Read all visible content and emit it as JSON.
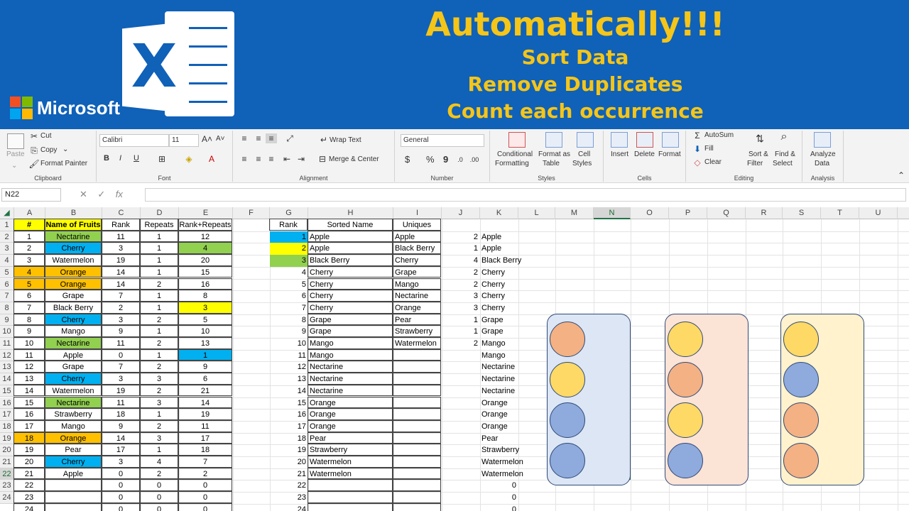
{
  "banner": {
    "title": "Automatically!!!",
    "line1": "Sort Data",
    "line2": "Remove Duplicates",
    "line3": "Count each occurrence",
    "brand": "Microsoft",
    "logo_letter": "X",
    "colors": {
      "bg": "#1061b8",
      "title": "#f5c518"
    }
  },
  "ribbon": {
    "clipboard": {
      "paste": "Paste",
      "cut": "Cut",
      "copy": "Copy",
      "format_painter": "Format Painter",
      "label": "Clipboard"
    },
    "font": {
      "name": "Calibri",
      "size": "11",
      "bold": "B",
      "italic": "I",
      "underline": "U",
      "label": "Font"
    },
    "alignment": {
      "wrap": "Wrap Text",
      "merge": "Merge & Center",
      "label": "Alignment"
    },
    "number": {
      "format": "General",
      "currency": "$",
      "percent": "%",
      "comma": "9",
      "label": "Number"
    },
    "styles": {
      "cond1": "Conditional",
      "cond2": "Formatting",
      "fmt1": "Format as",
      "fmt2": "Table",
      "cell1": "Cell",
      "cell2": "Styles",
      "label": "Styles"
    },
    "cells": {
      "insert": "Insert",
      "delete": "Delete",
      "format": "Format",
      "label": "Cells"
    },
    "editing": {
      "autosum": "AutoSum",
      "fill": "Fill",
      "clear": "Clear",
      "sort1": "Sort &",
      "sort2": "Filter",
      "find1": "Find &",
      "find2": "Select",
      "label": "Editing"
    },
    "analysis": {
      "an1": "Analyze",
      "an2": "Data",
      "label": "Analysis"
    }
  },
  "formula": {
    "name_box": "N22",
    "fx": "fx",
    "content": ""
  },
  "colors": {
    "yellow": "#ffff00",
    "green": "#92d050",
    "blue": "#00b0f0",
    "orange": "#ffc000",
    "selection": "#217346"
  },
  "grid": {
    "columns": [
      [
        "A",
        20,
        44
      ],
      [
        "B",
        64,
        80
      ],
      [
        "C",
        144,
        54
      ],
      [
        "D",
        198,
        54
      ],
      [
        "E",
        252,
        76
      ],
      [
        "F",
        328,
        52
      ],
      [
        "G",
        380,
        54
      ],
      [
        "H",
        434,
        120
      ],
      [
        "I",
        554,
        68
      ],
      [
        "J",
        622,
        54
      ],
      [
        "K",
        676,
        54
      ],
      [
        "L",
        730,
        52
      ],
      [
        "M",
        782,
        54
      ],
      [
        "N",
        836,
        52
      ],
      [
        "O",
        888,
        54
      ],
      [
        "P",
        942,
        54
      ],
      [
        "Q",
        996,
        54
      ],
      [
        "R",
        1050,
        52
      ],
      [
        "S",
        1102,
        54
      ],
      [
        "T",
        1156,
        54
      ],
      [
        "U",
        1210,
        54
      ]
    ],
    "row_numbers": [
      "1",
      "2",
      "3",
      "4",
      "5",
      "6",
      "7",
      "8",
      "9",
      "10",
      "11",
      "12",
      "13",
      "14",
      "15",
      "16",
      "17",
      "18",
      "19",
      "20",
      "21",
      "22",
      "23",
      "24"
    ],
    "active_col": "N",
    "active_row": "22",
    "table1": {
      "headers": [
        "#",
        "Name of Fruits",
        "Rank",
        "Repeats",
        "Rank+Repeats"
      ],
      "rows": [
        [
          "1",
          "Nectarine",
          "11",
          "1",
          "12"
        ],
        [
          "2",
          "Cherry",
          "3",
          "1",
          "4"
        ],
        [
          "3",
          "Watermelon",
          "19",
          "1",
          "20"
        ],
        [
          "4",
          "Orange",
          "14",
          "1",
          "15"
        ],
        [
          "5",
          "Orange",
          "14",
          "2",
          "16"
        ],
        [
          "6",
          "Grape",
          "7",
          "1",
          "8"
        ],
        [
          "7",
          "Black Berry",
          "2",
          "1",
          "3"
        ],
        [
          "8",
          "Cherry",
          "3",
          "2",
          "5"
        ],
        [
          "9",
          "Mango",
          "9",
          "1",
          "10"
        ],
        [
          "10",
          "Nectarine",
          "11",
          "2",
          "13"
        ],
        [
          "11",
          "Apple",
          "0",
          "1",
          "1"
        ],
        [
          "12",
          "Grape",
          "7",
          "2",
          "9"
        ],
        [
          "13",
          "Cherry",
          "3",
          "3",
          "6"
        ],
        [
          "14",
          "Watermelon",
          "19",
          "2",
          "21"
        ],
        [
          "15",
          "Nectarine",
          "11",
          "3",
          "14"
        ],
        [
          "16",
          "Strawberry",
          "18",
          "1",
          "19"
        ],
        [
          "17",
          "Mango",
          "9",
          "2",
          "11"
        ],
        [
          "18",
          "Orange",
          "14",
          "3",
          "17"
        ],
        [
          "19",
          "Pear",
          "17",
          "1",
          "18"
        ],
        [
          "20",
          "Cherry",
          "3",
          "4",
          "7"
        ],
        [
          "21",
          "Apple",
          "0",
          "2",
          "2"
        ],
        [
          "22",
          "",
          "0",
          "0",
          "0"
        ],
        [
          "23",
          "",
          "0",
          "0",
          "0"
        ],
        [
          "24",
          "",
          "0",
          "0",
          "0"
        ]
      ]
    },
    "table2": {
      "headers": [
        "Rank",
        "Sorted Name",
        "Uniques"
      ],
      "ranks": [
        "1",
        "2",
        "3",
        "4",
        "5",
        "6",
        "7",
        "8",
        "9",
        "10",
        "11",
        "12",
        "13",
        "14",
        "15",
        "16",
        "17",
        "18",
        "19",
        "20",
        "21",
        "22",
        "23",
        "24"
      ],
      "sorted": [
        "Apple",
        "Apple",
        "Black Berry",
        "Cherry",
        "Cherry",
        "Cherry",
        "Cherry",
        "Grape",
        "Grape",
        "Mango",
        "Mango",
        "Nectarine",
        "Nectarine",
        "Nectarine",
        "Orange",
        "Orange",
        "Orange",
        "Pear",
        "Strawberry",
        "Watermelon",
        "Watermelon",
        "",
        "",
        ""
      ],
      "uniques": [
        "Apple",
        "Black Berry",
        "Cherry",
        "Grape",
        "Mango",
        "Nectarine",
        "Orange",
        "Pear",
        "Strawberry",
        "Watermelon"
      ],
      "counts": [
        "2",
        "1",
        "4",
        "2",
        "2",
        "3",
        "3",
        "1",
        "1",
        "2"
      ],
      "k": [
        "Apple",
        "Apple",
        "Black Berry",
        "Cherry",
        "Cherry",
        "Cherry",
        "Cherry",
        "Grape",
        "Grape",
        "Mango",
        "Mango",
        "Nectarine",
        "Nectarine",
        "Nectarine",
        "Orange",
        "Orange",
        "Orange",
        "Pear",
        "Strawberry",
        "Watermelon",
        "Watermelon",
        "0",
        "0",
        "0"
      ]
    }
  },
  "cards": [
    {
      "bg": "#dce6f5",
      "balls": [
        "#f4b183",
        "#ffd966",
        "#8faadc",
        "#8faadc"
      ]
    },
    {
      "bg": "#fbe3d6",
      "balls": [
        "#ffd966",
        "#f4b183",
        "#ffd966",
        "#8faadc"
      ]
    },
    {
      "bg": "#fff2cc",
      "balls": [
        "#ffd966",
        "#8faadc",
        "#f4b183",
        "#f4b183"
      ]
    }
  ]
}
